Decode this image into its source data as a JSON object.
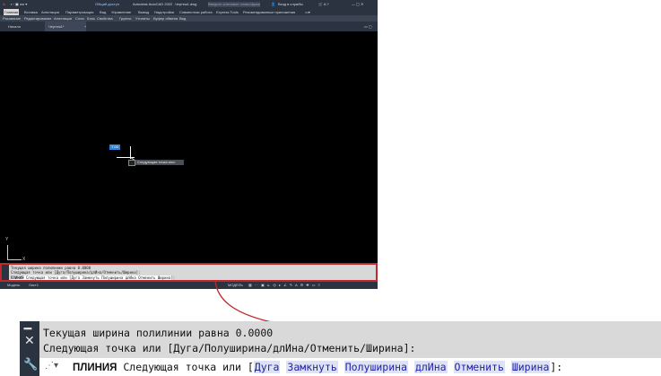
{
  "titlebar": {
    "shared_label": "Общий доступ",
    "app_title": "Autodesk AutoCAD 2022",
    "file_title": "Чертеж1.dwg",
    "search_placeholder": "Введите ключевое слово/фразу",
    "signin": "Вход в службы"
  },
  "ribbon_tabs": [
    "Главная",
    "Вставка",
    "Аннотации",
    "Параметризация",
    "Вид",
    "Управление",
    "Вывод",
    "Надстройки",
    "Совместная работа",
    "Express Tools",
    "Рекомендованные приложения"
  ],
  "panels": [
    "Рисование",
    "Редактирование",
    "Аннотации",
    "Слои",
    "Блок",
    "Свойства",
    "Группы",
    "Утилиты",
    "Буфер обмена",
    "Вид"
  ],
  "doc_tabs": [
    "Начало",
    "Чертеж1*"
  ],
  "viewport": {
    "tooltip": "Следующая точка или:",
    "dyn_input_value": "7.00",
    "ucs_x": "X",
    "ucs_y": "Y"
  },
  "status": {
    "model_tab": "Модель",
    "layout_tab": "Лист1",
    "model_label": "МОДЕЛЬ"
  },
  "command": {
    "history1": "Текущая ширина полилинии равна 0.0000",
    "history2": "Следующая точка или [Дуга/Полуширина/длИна/Отменить/Ширина]:",
    "command_name": "ПЛИНИЯ",
    "prompt": "Следующая точка или [",
    "options": [
      "Дуга",
      "Замкнуть",
      "Полуширина",
      "длИна",
      "Отменить",
      "Ширина"
    ],
    "end": "]:"
  },
  "colors": {
    "dark_chrome": "#2b3340",
    "highlight_red": "#c0282d",
    "option_bg": "#dde3f3"
  }
}
